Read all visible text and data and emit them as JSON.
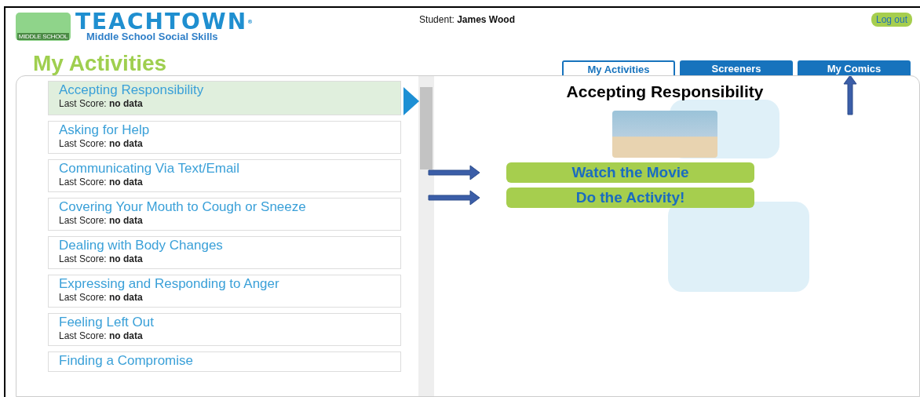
{
  "header": {
    "brand": "TEACHTOWN",
    "registered": "®",
    "subtitle": "Middle School Social Skills",
    "logo_caption": "MIDDLE SCHOOL",
    "student_label": "Student:",
    "student_name": "James Wood",
    "logout": "Log out"
  },
  "page_title": "My Activities",
  "tabs": [
    {
      "label": "My Activities",
      "selected": true
    },
    {
      "label": "Screeners",
      "selected": false
    },
    {
      "label": "My Comics",
      "selected": false
    }
  ],
  "activities": [
    {
      "title": "Accepting Responsibility",
      "score": "Last Score: **no data**",
      "selected": true
    },
    {
      "title": "Asking for Help",
      "score": "Last Score: **no data**",
      "selected": false
    },
    {
      "title": "Communicating Via Text/Email",
      "score": "Last Score: **no data**",
      "selected": false
    },
    {
      "title": "Covering Your Mouth to Cough or Sneeze",
      "score": "Last Score: **no data**",
      "selected": false
    },
    {
      "title": "Dealing with Body Changes",
      "score": "Last Score: **no data**",
      "selected": false
    },
    {
      "title": "Expressing and Responding to Anger",
      "score": "Last Score: **no data**",
      "selected": false
    },
    {
      "title": "Feeling Left Out",
      "score": "Last Score: **no data**",
      "selected": false
    },
    {
      "title": "Finding a Compromise",
      "selected": false
    }
  ],
  "detail": {
    "title": "Accepting Responsibility",
    "actions": [
      "Watch the Movie",
      "Do the Activity!"
    ]
  }
}
